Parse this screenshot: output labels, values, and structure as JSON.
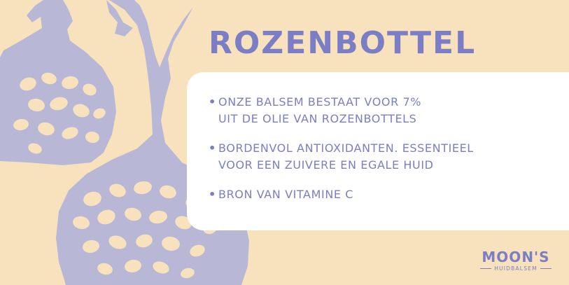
{
  "colors": {
    "background": "#F8E2BE",
    "illustration": "#B8B8D6",
    "accent": "#7B7EC4",
    "card": "#FFFFFF"
  },
  "title": "ROZENBOTTEL",
  "benefits": [
    {
      "bullet": "•",
      "text": "ONZE BALSEM BESTAAT VOOR 7%\nUIT DE OLIE VAN ROZENBOTTELS"
    },
    {
      "bullet": "•",
      "text": "BORDENVOL ANTIOXIDANTEN. ESSENTIEEL\nVOOR EEN ZUIVERE  EN EGALE HUID"
    },
    {
      "bullet": "•",
      "text": "BRON VAN VITAMINE C"
    }
  ],
  "brand": {
    "name": "MOON'S",
    "subtitle": "HUIDBALSEM"
  },
  "illustration": {
    "subject": "rose-hips-illustration"
  }
}
